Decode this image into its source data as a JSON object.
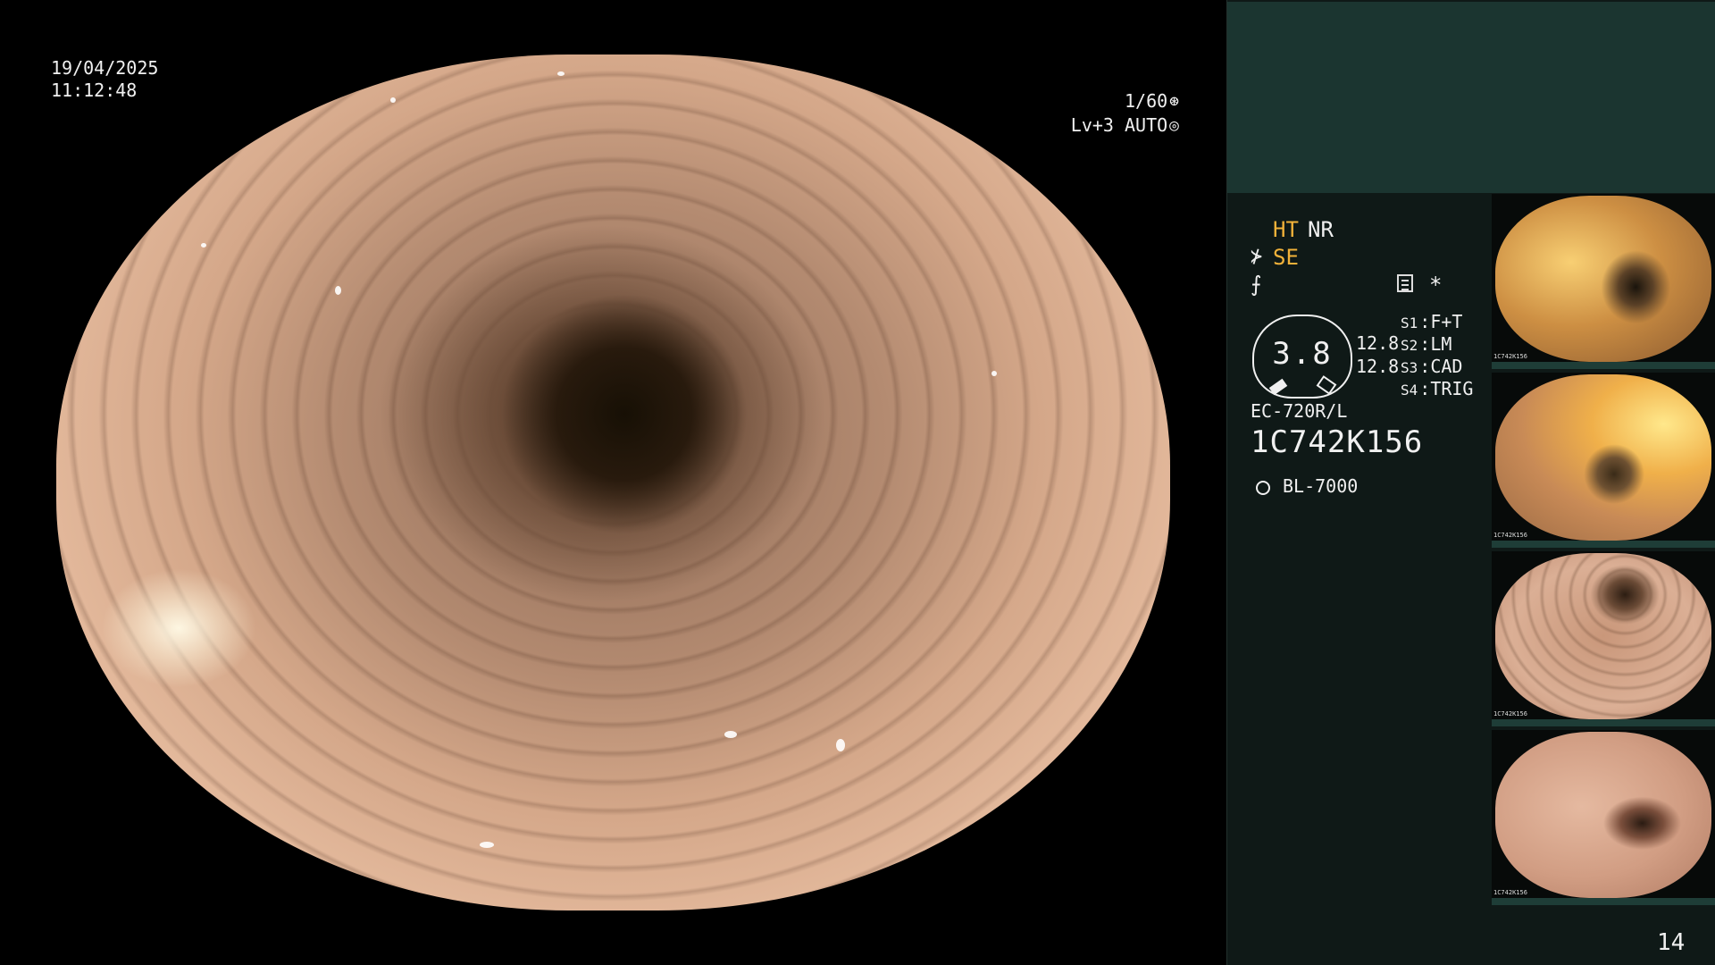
{
  "main": {
    "date": "19/04/2025",
    "time": "11:12:48",
    "shutter": "1/60",
    "shutter_icon": "⊛",
    "level": "Lv+3 AUTO",
    "level_icon": "◎"
  },
  "panel": {
    "modes": {
      "ht": "HT",
      "nr": "NR",
      "se": "SE",
      "se_icon": "⊁",
      "enhance_icon": "⨍",
      "star": "*"
    },
    "gauge": {
      "value": "3.8",
      "upper": "12.8",
      "lower": "12.8"
    },
    "switches": [
      {
        "key": "S1",
        "value": "F+T"
      },
      {
        "key": "S2",
        "value": "LM"
      },
      {
        "key": "S3",
        "value": "CAD"
      },
      {
        "key": "S4",
        "value": "TRIG"
      }
    ],
    "scope_model": "EC-720R/L",
    "serial": "1C742K156",
    "light_source": "BL-7000"
  },
  "thumbnails": [
    {
      "tag": "1C742K156"
    },
    {
      "tag": "1C742K156"
    },
    {
      "tag": "1C742K156"
    },
    {
      "tag": "1C742K156"
    }
  ],
  "page_number": "14",
  "colors": {
    "panel_top": "#1b3530",
    "accent": "#f2b23a"
  }
}
